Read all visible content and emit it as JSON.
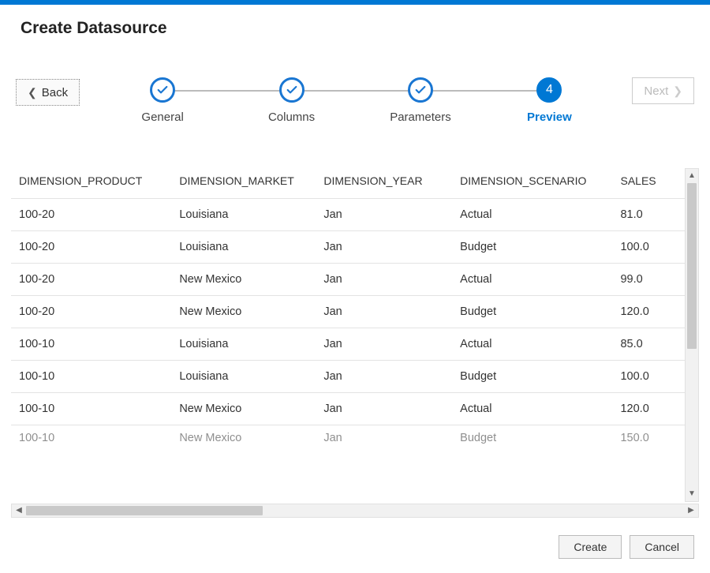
{
  "colors": {
    "accent": "#0078d4"
  },
  "header": {
    "title": "Create Datasource"
  },
  "wizard": {
    "back_label": "Back",
    "next_label": "Next",
    "current_step_number": "4",
    "steps": {
      "general": "General",
      "columns": "Columns",
      "parameters": "Parameters",
      "preview": "Preview"
    }
  },
  "table": {
    "columns": {
      "product": "DIMENSION_PRODUCT",
      "market": "DIMENSION_MARKET",
      "year": "DIMENSION_YEAR",
      "scenario": "DIMENSION_SCENARIO",
      "sales": "SALES"
    },
    "rows": [
      {
        "product": "100-20",
        "market": "Louisiana",
        "year": "Jan",
        "scenario": "Actual",
        "sales": "81.0"
      },
      {
        "product": "100-20",
        "market": "Louisiana",
        "year": "Jan",
        "scenario": "Budget",
        "sales": "100.0"
      },
      {
        "product": "100-20",
        "market": "New Mexico",
        "year": "Jan",
        "scenario": "Actual",
        "sales": "99.0"
      },
      {
        "product": "100-20",
        "market": "New Mexico",
        "year": "Jan",
        "scenario": "Budget",
        "sales": "120.0"
      },
      {
        "product": "100-10",
        "market": "Louisiana",
        "year": "Jan",
        "scenario": "Actual",
        "sales": "85.0"
      },
      {
        "product": "100-10",
        "market": "Louisiana",
        "year": "Jan",
        "scenario": "Budget",
        "sales": "100.0"
      },
      {
        "product": "100-10",
        "market": "New Mexico",
        "year": "Jan",
        "scenario": "Actual",
        "sales": "120.0"
      },
      {
        "product": "100-10",
        "market": "New Mexico",
        "year": "Jan",
        "scenario": "Budget",
        "sales": "150.0"
      }
    ]
  },
  "footer": {
    "create_label": "Create",
    "cancel_label": "Cancel"
  }
}
